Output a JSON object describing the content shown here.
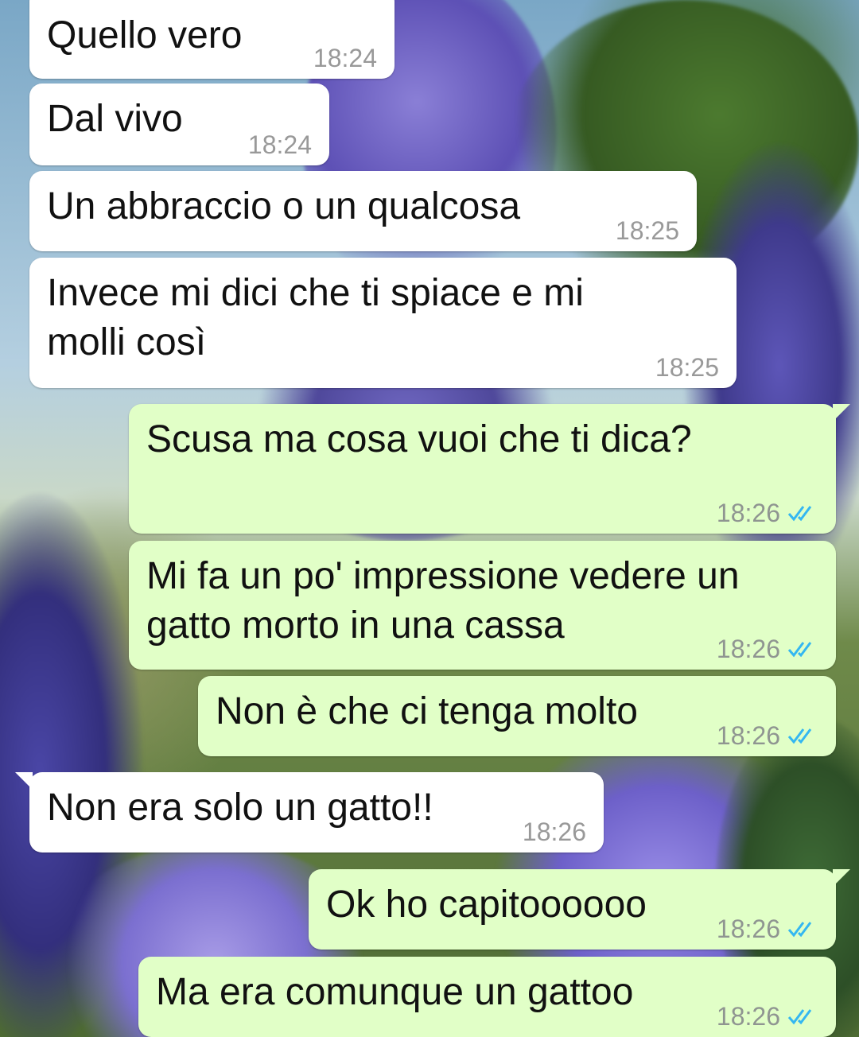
{
  "chat": {
    "messages": [
      {
        "direction": "in",
        "text": "Quello vero",
        "time": "18:24"
      },
      {
        "direction": "in",
        "text": "Dal vivo",
        "time": "18:24"
      },
      {
        "direction": "in",
        "text": "Un abbraccio o un qualcosa",
        "time": "18:25"
      },
      {
        "direction": "in",
        "text": "Invece mi dici che ti spiace e mi\nmolli così",
        "time": "18:25"
      },
      {
        "direction": "out",
        "text": "Scusa ma cosa vuoi che ti dica?",
        "time": "18:26",
        "status": "read"
      },
      {
        "direction": "out",
        "text": "Mi fa un po' impressione vedere un\ngatto morto in una cassa",
        "time": "18:26",
        "status": "read"
      },
      {
        "direction": "out",
        "text": "Non è che ci tenga molto",
        "time": "18:26",
        "status": "read"
      },
      {
        "direction": "in",
        "text": "Non era solo un gatto!!",
        "time": "18:26"
      },
      {
        "direction": "out",
        "text": "Ok ho capitoooooo",
        "time": "18:26",
        "status": "read"
      },
      {
        "direction": "out",
        "text": "Ma era comunque un gattoo",
        "time": "18:26",
        "status": "read"
      }
    ],
    "read_tick_icon": "double-check-icon",
    "colors": {
      "incoming_bubble": "#ffffff",
      "outgoing_bubble": "#e1ffc7",
      "read_tick": "#34b7f1",
      "timestamp": "#999999"
    }
  }
}
